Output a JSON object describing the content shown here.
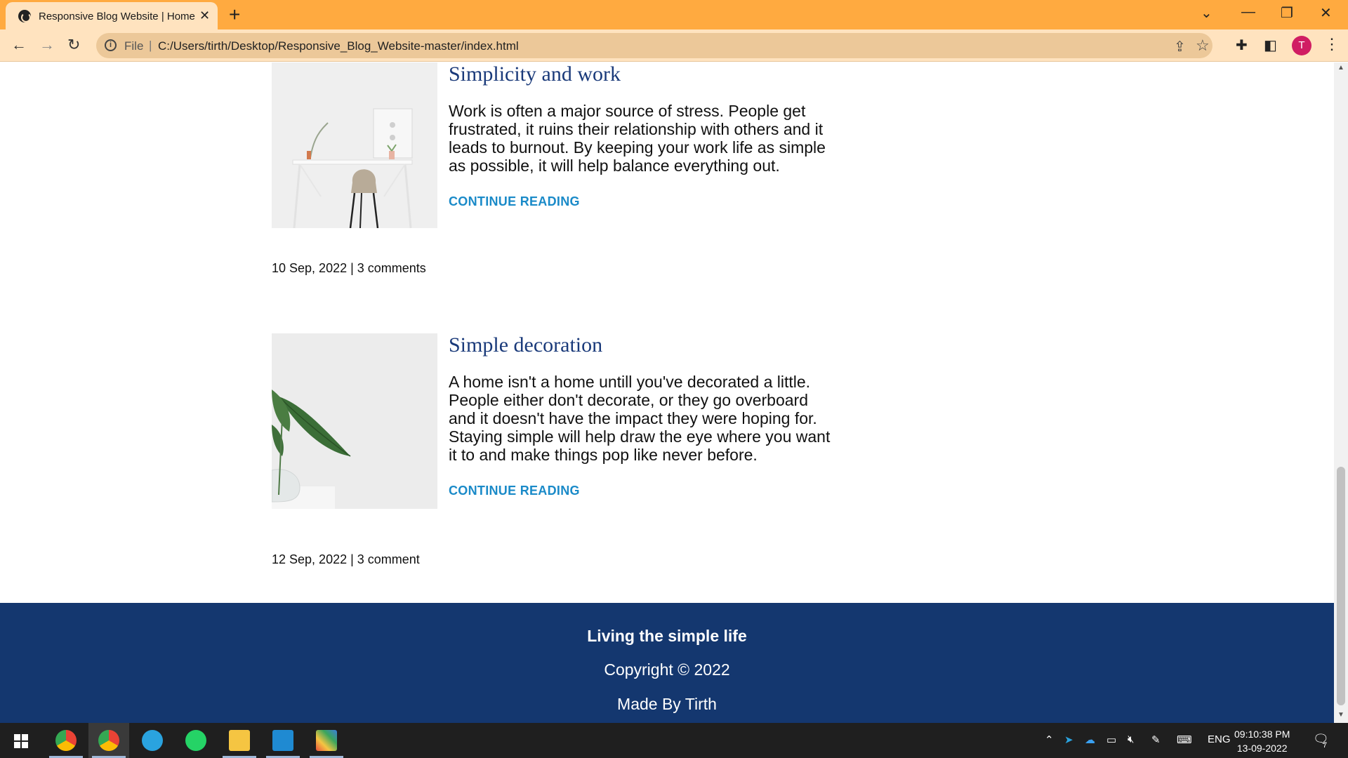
{
  "browser": {
    "tab_title": "Responsive Blog Website | Home",
    "address_scheme": "File",
    "address_url": "C:/Users/tirth/Desktop/Responsive_Blog_Website-master/index.html",
    "profile_initial": "T"
  },
  "posts": [
    {
      "title": "Simplicity and work",
      "excerpt": "Work is often a major source of stress. People get frustrated, it ruins their relationship with others and it leads to burnout. By keeping your work life as simple as possible, it will help balance everything out.",
      "link_label": "CONTINUE READING",
      "meta": "10 Sep, 2022 | 3 comments"
    },
    {
      "title": "Simple decoration",
      "excerpt": "A home isn't a home untill you've decorated a little. People either don't decorate, or they go overboard and it doesn't have the impact they were hoping for. Staying simple will help draw the eye where you want it to and make things pop like never before.",
      "link_label": "CONTINUE READING",
      "meta": "12 Sep, 2022 | 3 comment"
    }
  ],
  "footer": {
    "tagline": "Living the simple life",
    "copyright": "Copyright © 2022",
    "credit": "Made By Tirth"
  },
  "taskbar": {
    "language": "ENG",
    "time": "09:10:38 PM",
    "date": "13-09-2022",
    "notification_count": "7"
  },
  "colors": {
    "tabbar": "#ffaa40",
    "toolbar": "#ffe3bf",
    "heading": "#1a3a7a",
    "link": "#1a8ac8",
    "footer_bg": "#14376f"
  }
}
